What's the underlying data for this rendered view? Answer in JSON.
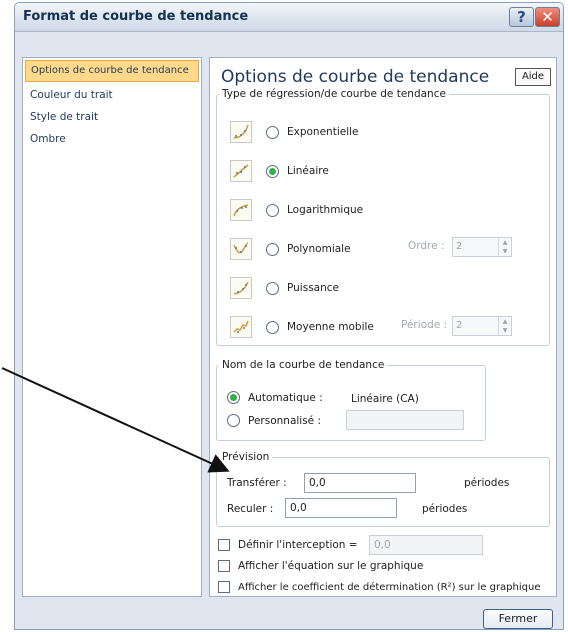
{
  "window": {
    "title": "Format de courbe de tendance",
    "help_glyph": "?",
    "close_glyph": "✕"
  },
  "nav": {
    "items": [
      {
        "label": "Options de courbe de tendance",
        "selected": true
      },
      {
        "label": "Couleur du trait"
      },
      {
        "label": "Style de trait"
      },
      {
        "label": "Ombre"
      }
    ]
  },
  "panel": {
    "title": "Options de courbe de tendance",
    "help_button": "Aide",
    "regression_group": {
      "legend": "Type de régression/de courbe de tendance",
      "options": [
        {
          "label": "Exponentielle",
          "selected": false
        },
        {
          "label": "Linéaire",
          "selected": true
        },
        {
          "label": "Logarithmique",
          "selected": false
        },
        {
          "label": "Polynomiale",
          "selected": false
        },
        {
          "label": "Puissance",
          "selected": false
        },
        {
          "label": "Moyenne mobile",
          "selected": false
        }
      ],
      "order_label": "Ordre :",
      "order_value": "2",
      "period_label": "Période :",
      "period_value": "2"
    },
    "name_group": {
      "legend": "Nom de la courbe de tendance",
      "auto_label": "Automatique :",
      "auto_value": "Linéaire (CA)",
      "custom_label": "Personnalisé :",
      "custom_value": ""
    },
    "forecast_group": {
      "legend": "Prévision",
      "forward_label": "Transférer :",
      "forward_value": "0,0",
      "forward_unit": "périodes",
      "backward_label": "Reculer :",
      "backward_value": "0,0",
      "backward_unit": "périodes"
    },
    "options": {
      "intercept_label": "Définir l'interception =",
      "intercept_value": "0,0",
      "show_equation_label": "Afficher l'équation sur le graphique",
      "show_r2_label": "Afficher le coefficient de détermination (R²) sur le graphique"
    }
  },
  "footer": {
    "close_button": "Fermer"
  },
  "colors": {
    "selected_nav": "#ffd98a",
    "radio_selected": "#2fb24a",
    "title_text": "#15314f"
  }
}
